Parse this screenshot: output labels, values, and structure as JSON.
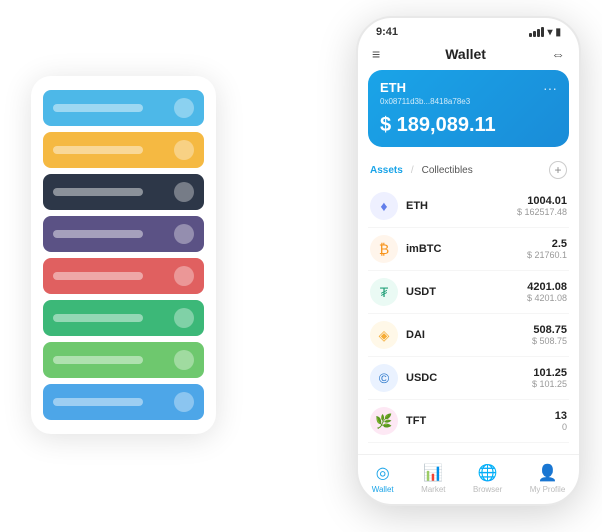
{
  "scene": {
    "card_stack": {
      "cards": [
        {
          "color": "#4db8e8",
          "label_width": "80px"
        },
        {
          "color": "#f5b942",
          "label_width": "75px"
        },
        {
          "color": "#2d3748",
          "label_width": "70px"
        },
        {
          "color": "#5b5285",
          "label_width": "85px"
        },
        {
          "color": "#e06060",
          "label_width": "70px"
        },
        {
          "color": "#3cb878",
          "label_width": "80px"
        },
        {
          "color": "#6ec86e",
          "label_width": "75px"
        },
        {
          "color": "#4da6e8",
          "label_width": "85px"
        }
      ]
    },
    "phone": {
      "status_bar": {
        "time": "9:41"
      },
      "nav_header": {
        "menu_label": "≡",
        "title": "Wallet",
        "expand_label": "⇔"
      },
      "eth_card": {
        "title": "ETH",
        "address": "0x08711d3b...8418a78e3",
        "balance": "$ 189,089.11"
      },
      "assets_header": {
        "tab_assets": "Assets",
        "divider": "/",
        "tab_collectibles": "Collectibles",
        "add_label": "+"
      },
      "assets": [
        {
          "symbol": "ETH",
          "icon": "♦",
          "icon_color": "#627eea",
          "bg_color": "#eef0ff",
          "amount": "1004.01",
          "usd": "$ 162517.48"
        },
        {
          "symbol": "imBTC",
          "icon": "₿",
          "icon_color": "#f7931a",
          "bg_color": "#fff5eb",
          "amount": "2.5",
          "usd": "$ 21760.1"
        },
        {
          "symbol": "USDT",
          "icon": "₮",
          "icon_color": "#26a17b",
          "bg_color": "#eafaf4",
          "amount": "4201.08",
          "usd": "$ 4201.08"
        },
        {
          "symbol": "DAI",
          "icon": "◈",
          "icon_color": "#f5ac37",
          "bg_color": "#fff8e8",
          "amount": "508.75",
          "usd": "$ 508.75"
        },
        {
          "symbol": "USDC",
          "icon": "©",
          "icon_color": "#2775ca",
          "bg_color": "#eaf2ff",
          "amount": "101.25",
          "usd": "$ 101.25"
        },
        {
          "symbol": "TFT",
          "icon": "🌿",
          "icon_color": "#e91e8c",
          "bg_color": "#fde8f4",
          "amount": "13",
          "usd": "0"
        }
      ],
      "bottom_nav": [
        {
          "label": "Wallet",
          "icon": "◎",
          "active": true
        },
        {
          "label": "Market",
          "icon": "📊",
          "active": false
        },
        {
          "label": "Browser",
          "icon": "🌐",
          "active": false
        },
        {
          "label": "My Profile",
          "icon": "👤",
          "active": false
        }
      ]
    }
  }
}
